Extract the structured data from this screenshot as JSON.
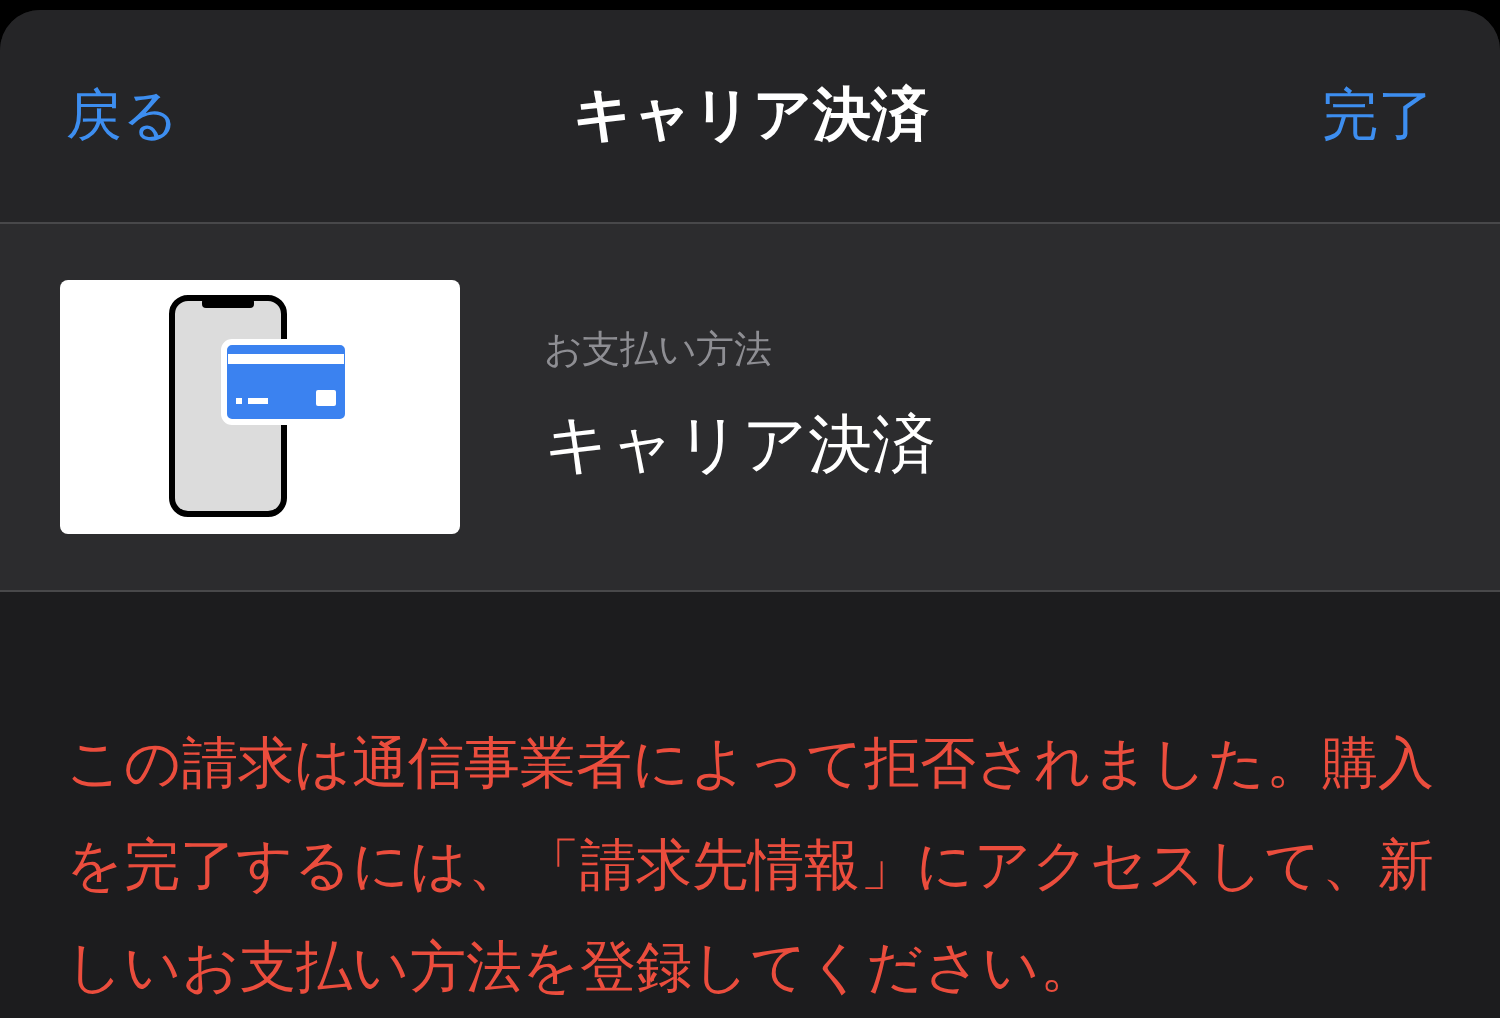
{
  "nav": {
    "back": "戻る",
    "title": "キャリア決済",
    "done": "完了"
  },
  "payment": {
    "label": "お支払い方法",
    "value": "キャリア決済"
  },
  "error": "この請求は通信事業者によって拒否されました。購入を完了するには、「請求先情報」にアクセスして、新しいお支払い方法を登録してください。"
}
